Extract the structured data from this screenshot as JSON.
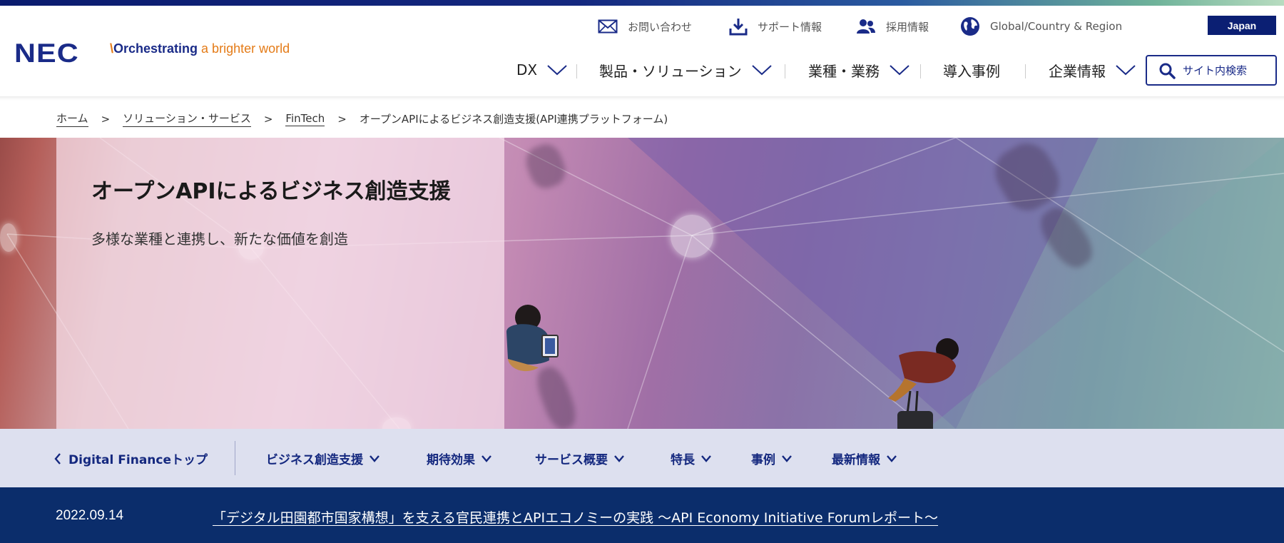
{
  "header": {
    "logo": "NEC",
    "tagline": {
      "slash": "\\",
      "part1": "Orchestrating",
      "part2": " a brighter world"
    },
    "utility": [
      {
        "label": "お問い合わせ",
        "icon": "mail-icon"
      },
      {
        "label": "サポート情報",
        "icon": "download-icon"
      },
      {
        "label": "採用情報",
        "icon": "people-icon"
      },
      {
        "label": "Global/Country & Region",
        "icon": "globe-icon"
      }
    ],
    "region_button": "Japan",
    "nav": [
      {
        "label": "DX",
        "has_dropdown": true
      },
      {
        "label": "製品・ソリューション",
        "has_dropdown": true
      },
      {
        "label": "業種・業務",
        "has_dropdown": true
      },
      {
        "label": "導入事例",
        "has_dropdown": false
      },
      {
        "label": "企業情報",
        "has_dropdown": true
      }
    ],
    "search_label": "サイト内検索"
  },
  "breadcrumb": {
    "items": [
      "ホーム",
      "ソリューション・サービス",
      "FinTech"
    ],
    "separator": ">",
    "current": "オープンAPIによるビジネス創造支援(API連携プラットフォーム)"
  },
  "hero": {
    "title": "オープンAPIによるビジネス創造支援",
    "subtitle": "多様な業種と連携し、新たな価値を創造"
  },
  "subnav": {
    "back_label": "Digital Financeトップ",
    "items": [
      "ビジネス創造支援",
      "期待効果",
      "サービス概要",
      "特長",
      "事例",
      "最新情報"
    ]
  },
  "news": {
    "date": "2022.09.14",
    "title": "「デジタル田園都市国家構想」を支える官民連携とAPIエコノミーの実践 ～API Economy Initiative Forumレポート～"
  },
  "colors": {
    "brand_navy": "#1a2b88",
    "accent_orange": "#e47b17",
    "subnav_bg": "#dde0ef",
    "newsbar_bg": "#0b2d6b"
  }
}
